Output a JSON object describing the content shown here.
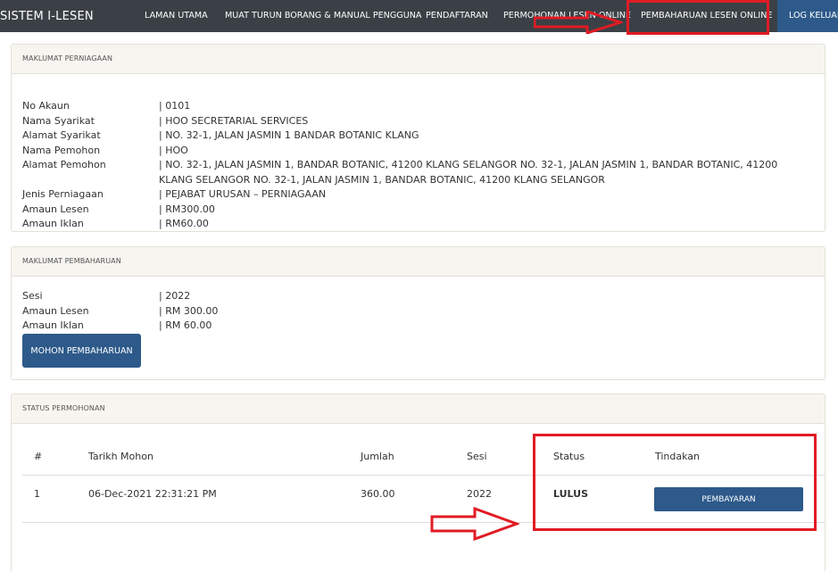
{
  "navbar": {
    "brand": "SISTEM I-LESEN",
    "items": [
      "LAMAN UTAMA",
      "MUAT TURUN BORANG & MANUAL PENGGUNA",
      "PENDAFTARAN",
      "PERMOHONAN LESEN ONLINE",
      "PEMBAHARUAN LESEN ONLINE"
    ],
    "logout": "LOG KELUAR"
  },
  "business": {
    "title": "MAKLUMAT PERNIAGAAN",
    "rows": [
      {
        "label": "No Akaun",
        "value": "| 0101"
      },
      {
        "label": "Nama Syarikat",
        "value": "| HOO SECRETARIAL SERVICES"
      },
      {
        "label": "Alamat Syarikat",
        "value": "| NO. 32-1, JALAN JASMIN 1 BANDAR BOTANIC KLANG"
      },
      {
        "label": "Nama Pemohon",
        "value": "| HOO"
      },
      {
        "label": "Alamat Pemohon",
        "value": "| NO. 32-1, JALAN JASMIN 1, BANDAR BOTANIC, 41200 KLANG SELANGOR NO. 32-1, JALAN JASMIN 1, BANDAR BOTANIC, 41200 KLANG SELANGOR NO. 32-1, JALAN JASMIN 1, BANDAR BOTANIC, 41200 KLANG SELANGOR"
      },
      {
        "label": "Jenis Perniagaan",
        "value": "| PEJABAT URUSAN – PERNIAGAAN"
      },
      {
        "label": "Amaun Lesen",
        "value": "| RM300.00"
      },
      {
        "label": "Amaun Iklan",
        "value": "| RM60.00"
      }
    ]
  },
  "renewal": {
    "title": "MAKLUMAT PEMBAHARUAN",
    "rows": [
      {
        "label": "Sesi",
        "value": "| 2022"
      },
      {
        "label": "Amaun Lesen",
        "value": "| RM 300.00"
      },
      {
        "label": "Amaun Iklan",
        "value": "| RM 60.00"
      }
    ],
    "button": "MOHON PEMBAHARUAN"
  },
  "status": {
    "title": "STATUS PERMOHONAN",
    "headers": [
      "#",
      "Tarikh Mohon",
      "Jumlah",
      "Sesi",
      "Status",
      "Tindakan"
    ],
    "rows": [
      {
        "no": "1",
        "date": "06-Dec-2021 22:31:21 PM",
        "amount": "360.00",
        "session": "2022",
        "status": "LULUS",
        "action": "PEMBAYARAN"
      }
    ]
  },
  "colors": {
    "navbar": "#3b4046",
    "primary": "#2d5a8a",
    "annotation": "#e01b24"
  }
}
